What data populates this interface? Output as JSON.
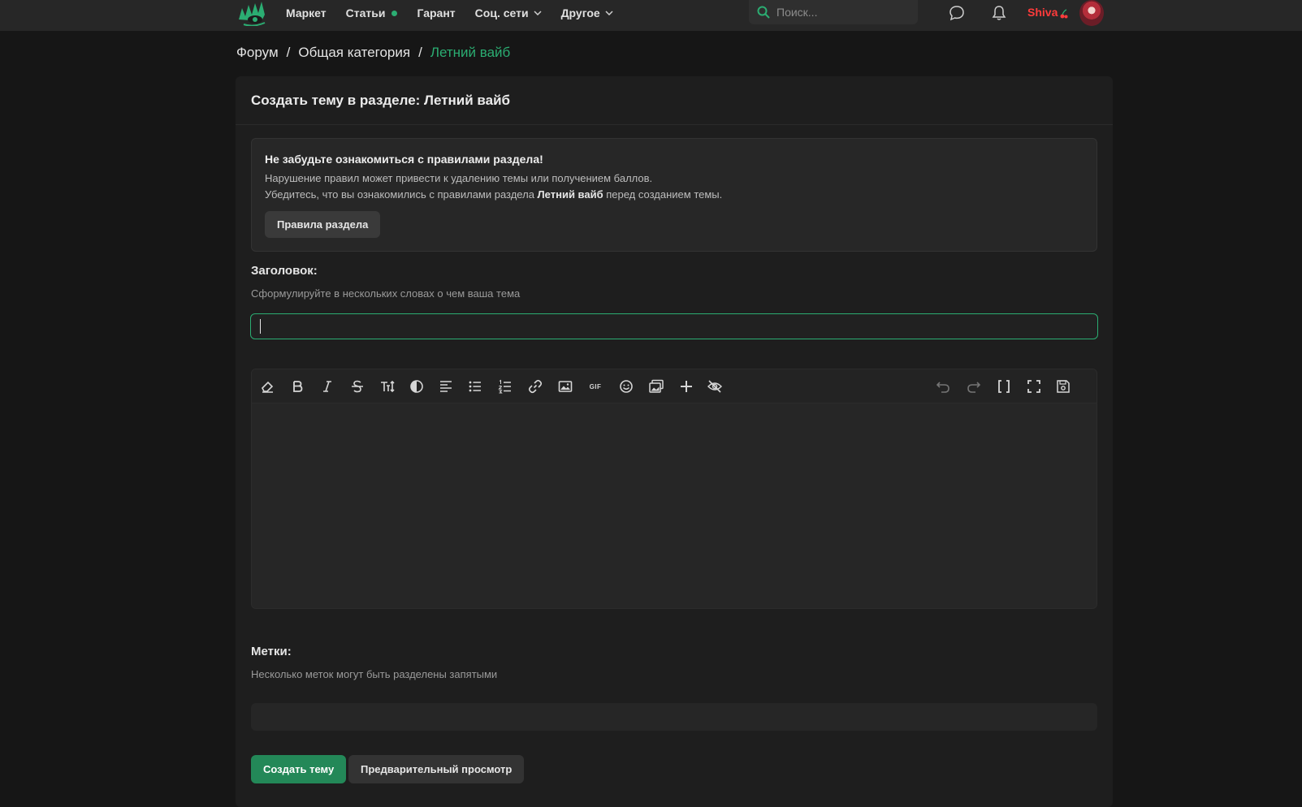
{
  "header": {
    "logo": "lolz-logo-icon",
    "nav": [
      {
        "label": "Маркет"
      },
      {
        "label": "Статьи",
        "dot": true
      },
      {
        "label": "Гарант"
      },
      {
        "label": "Соц. сети",
        "dropdown": true
      },
      {
        "label": "Другое",
        "dropdown": true
      }
    ],
    "search_placeholder": "Поиск...",
    "username": "Shiva",
    "accent": "#2bad72",
    "username_color": "#ff3b3b"
  },
  "breadcrumb": [
    "Форум",
    "Общая категория",
    "Летний вайб"
  ],
  "panel": {
    "title": "Создать тему в разделе: Летний вайб",
    "notice": {
      "title": "Не забудьте ознакомиться с правилами раздела!",
      "line1": "Нарушение правил может привести к удалению темы или получением баллов.",
      "line2_before": "Убедитесь, что вы ознакомились с правилами раздела ",
      "line2_bold": "Летний вайб",
      "line2_after": " перед созданием темы.",
      "button": "Правила раздела"
    },
    "title_field": {
      "label": "Заголовок:",
      "hint": "Сформулируйте в нескольких словах о чем ваша тема",
      "value": ""
    },
    "editor": {
      "toolbar_left": [
        "eraser-icon",
        "bold-icon",
        "italic-icon",
        "strikethrough-icon",
        "text-size-icon",
        "color-icon",
        "align-icon",
        "bullet-list-icon",
        "numbered-list-icon",
        "link-icon",
        "image-icon",
        "gif-icon",
        "emoji-icon",
        "gallery-icon",
        "insert-plus-icon",
        "hide-icon"
      ],
      "toolbar_right": [
        "undo-icon",
        "redo-icon",
        "bbcode-toggle-icon",
        "fullscreen-icon",
        "save-draft-icon"
      ],
      "gif_label": "GIF"
    },
    "tags_field": {
      "label": "Метки:",
      "hint": "Несколько меток могут быть разделены запятыми",
      "value": ""
    },
    "submit_button": "Создать тему",
    "preview_button": "Предварительный просмотр"
  }
}
